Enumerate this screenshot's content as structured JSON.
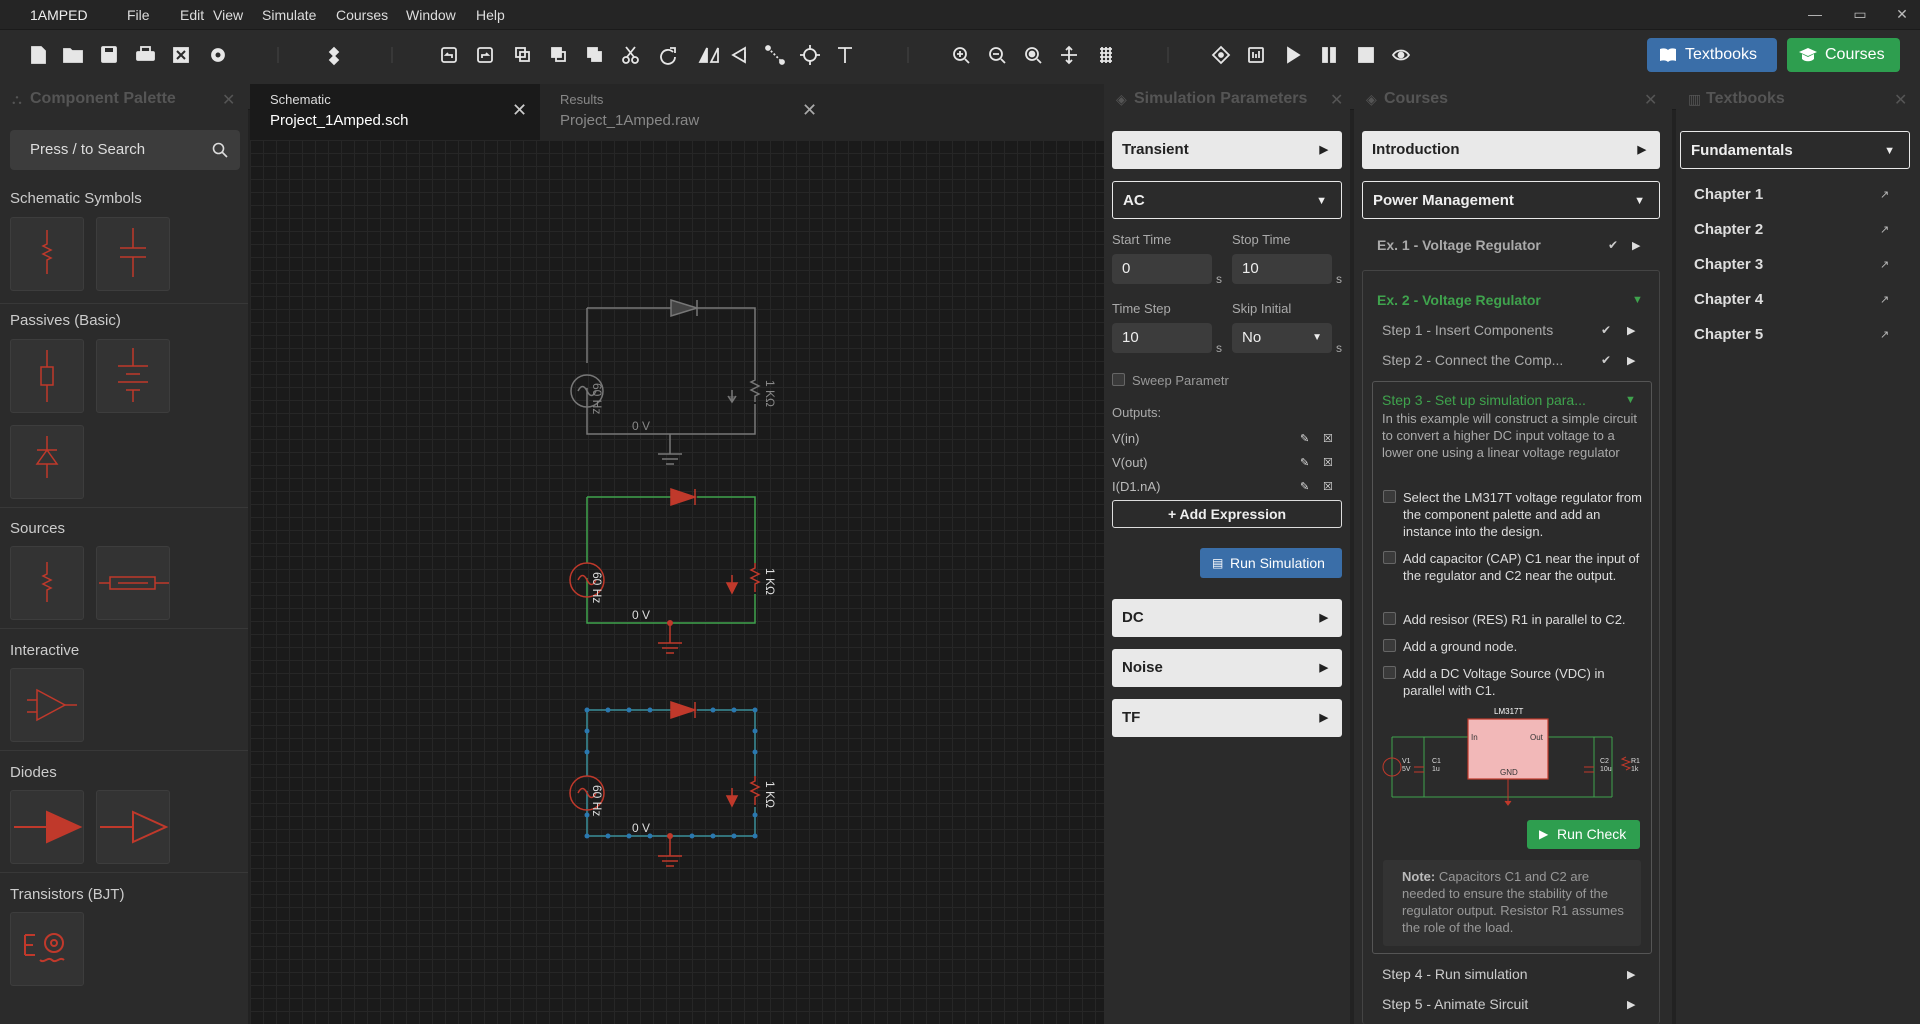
{
  "app": {
    "name": "1AMPED"
  },
  "menu": [
    "File",
    "Edit",
    "View",
    "Simulate",
    "Courses",
    "Window",
    "Help"
  ],
  "window_controls": {
    "minimize": "—",
    "maximize": "▭",
    "close": "✕"
  },
  "toolbar": {
    "textbooks_label": "Textbooks",
    "courses_label": "Courses",
    "textbooks_color": "#3a6ea8",
    "courses_color": "#2e9e4f"
  },
  "palette": {
    "title": "Component Palette",
    "search_placeholder": "Press / to Search",
    "sections": [
      "Schematic Symbols",
      "Passives (Basic)",
      "Sources",
      "Interactive",
      "Diodes",
      "Transistors (BJT)"
    ]
  },
  "tabs": [
    {
      "label": "Schematic",
      "file": "Project_1Amped.sch"
    },
    {
      "label": "Results",
      "file": "Project_1Amped.raw"
    }
  ],
  "circuit_labels": {
    "source": "60 Hz",
    "load": "1 KΩ",
    "ground": "0 V"
  },
  "sim": {
    "title": "Simulation Parameters",
    "transient": "Transient",
    "ac": "AC",
    "start_time_label": "Start Time",
    "start_time": "0",
    "stop_time_label": "Stop Time",
    "stop_time": "10",
    "time_step_label": "Time Step",
    "time_step": "10",
    "skip_initial_label": "Skip Initial",
    "skip_initial": "No",
    "unit": "s",
    "sweep_label": "Sweep Parametr",
    "outputs_label": "Outputs:",
    "outputs": [
      "V(in)",
      "V(out)",
      "I(D1.nA)"
    ],
    "add_expression": "+ Add Expression",
    "run_simulation": "Run Simulation",
    "dc": "DC",
    "noise": "Noise",
    "tf": "TF"
  },
  "courses": {
    "title": "Courses",
    "intro": "Introduction",
    "power": "Power Management",
    "ex1": "Ex. 1 - Voltage Regulator",
    "ex2": "Ex. 2 - Voltage Regulator",
    "step1": "Step 1 - Insert Components",
    "step2": "Step 2 - Connect the Comp...",
    "step3": "Step 3 - Set up simulation para...",
    "step3_desc": "In this example will construct a simple circuit to convert a higher DC input voltage to a lower one using a linear voltage regulator",
    "tasks": [
      "Select the LM317T voltage regulator from the component palette and add an instance into the design.",
      "Add capacitor (CAP) C1 near the input of the regulator and C2 near the output.",
      "Add resisor (RES) R1 in parallel to C2.",
      "Add a ground node.",
      "Add a DC Voltage Source (VDC) in parallel with C1."
    ],
    "diagram": {
      "chip": "LM317T",
      "in": "In",
      "out": "Out",
      "gnd": "GND",
      "v1": "V1",
      "v1val": "5V",
      "c1": "C1",
      "c1val": "1u",
      "c2": "C2",
      "c2val": "10u",
      "r1": "R1",
      "r1val": "1k"
    },
    "run_check": "Run Check",
    "note_label": "Note:",
    "note": "Capacitors C1 and C2 are needed to ensure the stability of the regulator output. Resistor R1 assumes the role of the load.",
    "step4": "Step 4 - Run simulation",
    "step5": "Step 5 - Animate Sircuit"
  },
  "textbooks": {
    "title": "Textbooks",
    "selected": "Fundamentals",
    "chapters": [
      "Chapter 1",
      "Chapter 2",
      "Chapter 3",
      "Chapter 4",
      "Chapter 5"
    ]
  }
}
